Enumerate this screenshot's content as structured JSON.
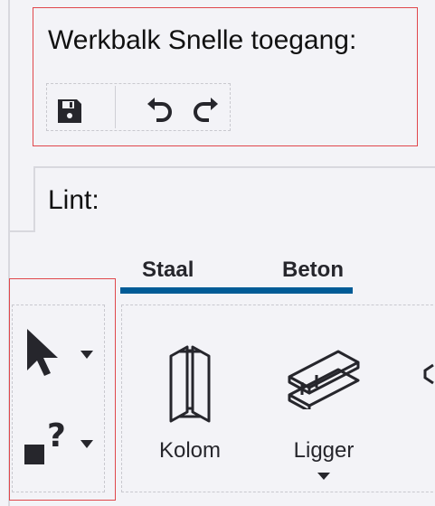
{
  "qat": {
    "title": "Werkbalk Snelle toegang:",
    "icons": [
      "save-icon",
      "undo-icon",
      "redo-icon"
    ]
  },
  "ribbon": {
    "title": "Lint:",
    "tabs": [
      {
        "label": "Staal",
        "active": true
      },
      {
        "label": "Beton",
        "active": true
      }
    ],
    "side_tools": [
      "select-pointer-icon",
      "help-query-icon"
    ],
    "tools": [
      {
        "label": "Kolom",
        "icon": "column-icon"
      },
      {
        "label": "Ligger",
        "icon": "beam-icon"
      }
    ]
  },
  "colors": {
    "accent": "#005b96",
    "highlight": "#e0474c",
    "background": "#f3f3f7",
    "icon": "#26262c"
  }
}
